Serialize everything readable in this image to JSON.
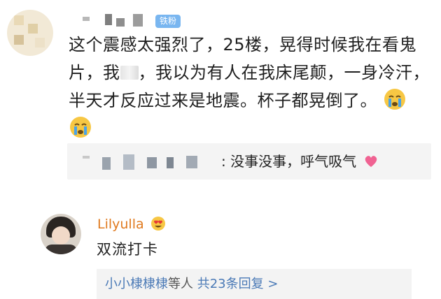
{
  "comment1": {
    "badge": "铁粉",
    "text_part1": "这个震感太强烈了，25楼，晃得时候我在看鬼片，我",
    "text_part2": "，我以为有人在我床尾颠，一身冷汗，半天才反应过来是地震。杯子都晃倒了。",
    "emoji": "crying-face",
    "reply_preview": {
      "text": ": 没事没事，呼气吸气",
      "emoji": "heart"
    }
  },
  "comment2": {
    "username": "Lilyulla",
    "username_emoji": "heart-eyes",
    "text": "双流打卡",
    "replies": {
      "users": "小小棣棣棣",
      "middle": "等人 ",
      "count_label": "共23条回复 >"
    }
  },
  "colors": {
    "badge": "#79b6f0",
    "username": "#e07a1f",
    "link": "#4a79b6"
  }
}
